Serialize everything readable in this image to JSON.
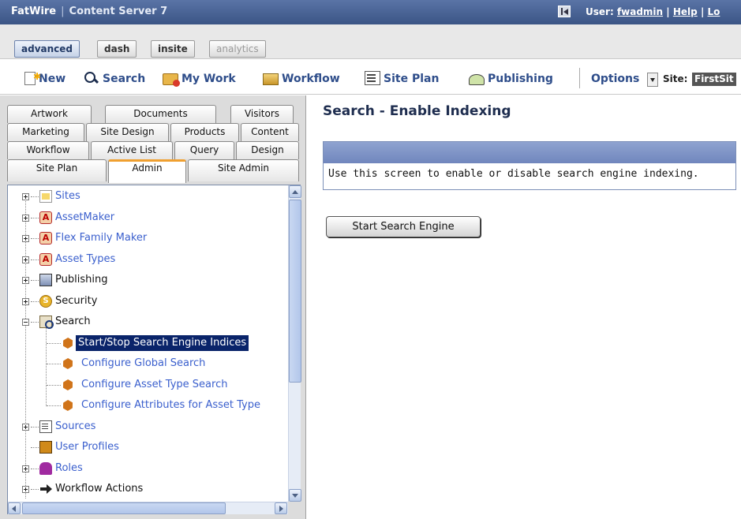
{
  "titlebar": {
    "brand": "FatWire",
    "product": "Content Server 7",
    "user_label": "User:",
    "user_name": "fwadmin",
    "help": "Help",
    "logout": "Lo",
    "sep1": "|",
    "sep2": "|"
  },
  "modes": [
    "advanced",
    "dash",
    "insite",
    "analytics"
  ],
  "toolbar": {
    "new": "New",
    "search": "Search",
    "mywork": "My Work",
    "workflow": "Workflow",
    "siteplan": "Site Plan",
    "publishing": "Publishing",
    "options": "Options",
    "site_label": "Site:",
    "site_value": "FirstSit"
  },
  "tabs": {
    "row1": [
      "Artwork",
      "Documents",
      "Visitors"
    ],
    "row2": [
      "Marketing",
      "Site Design",
      "Products",
      "Content"
    ],
    "row3": [
      "Workflow",
      "Active List",
      "Query",
      "Design"
    ],
    "row4": [
      "Site Plan",
      "Admin",
      "Site Admin"
    ]
  },
  "tree": {
    "items": [
      {
        "label": "Sites",
        "icon": "sites-icon"
      },
      {
        "label": "AssetMaker",
        "icon": "assetmaker-icon"
      },
      {
        "label": "Flex Family Maker",
        "icon": "flex-family-icon"
      },
      {
        "label": "Asset Types",
        "icon": "asset-types-icon"
      },
      {
        "label": "Publishing",
        "icon": "publishing-icon"
      },
      {
        "label": "Security",
        "icon": "security-icon"
      },
      {
        "label": "Search",
        "icon": "search-icon"
      },
      {
        "label": "Start/Stop Search Engine Indices",
        "icon": "search-engine-icon"
      },
      {
        "label": "Configure Global Search",
        "icon": "global-search-icon"
      },
      {
        "label": "Configure Asset Type Search",
        "icon": "asset-type-search-icon"
      },
      {
        "label": "Configure Attributes for Asset Type",
        "icon": "attributes-search-icon"
      },
      {
        "label": "Sources",
        "icon": "sources-icon"
      },
      {
        "label": "User Profiles",
        "icon": "user-profiles-icon"
      },
      {
        "label": "Roles",
        "icon": "roles-icon"
      },
      {
        "label": "Workflow Actions",
        "icon": "workflow-actions-icon"
      }
    ]
  },
  "main": {
    "title": "Search - Enable Indexing",
    "description": "Use this screen to enable or disable search engine indexing.",
    "start_button": "Start Search Engine"
  },
  "colors": {
    "titlebar": "#3b5585",
    "link": "#3a5fcd",
    "selection": "#0a246a",
    "active_tab_accent": "#f0a030"
  }
}
